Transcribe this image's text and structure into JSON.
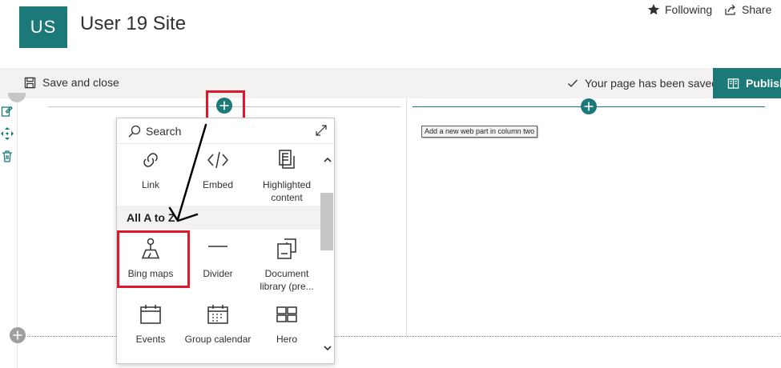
{
  "site": {
    "logo_text": "US",
    "title": "User 19 Site"
  },
  "header_actions": {
    "following_label": "Following",
    "share_label": "Share"
  },
  "command_bar": {
    "save_close_label": "Save and close",
    "saved_status": "Your page has been saved",
    "publish_label": "Publish"
  },
  "tooltip": {
    "text": "Add a new web part in column two"
  },
  "toolbox": {
    "search_placeholder": "Search",
    "top_items": [
      {
        "label": "Link",
        "icon": "link-icon"
      },
      {
        "label": "Embed",
        "icon": "embed-icon"
      },
      {
        "label": "Highlighted content",
        "icon": "highlighted-content-icon"
      }
    ],
    "section_label": "All A to Z",
    "items": [
      {
        "label": "Bing maps",
        "icon": "bing-maps-icon"
      },
      {
        "label": "Divider",
        "icon": "divider-icon"
      },
      {
        "label": "Document library (pre...",
        "icon": "document-library-icon"
      },
      {
        "label": "Events",
        "icon": "events-icon"
      },
      {
        "label": "Group calendar",
        "icon": "group-calendar-icon"
      },
      {
        "label": "Hero",
        "icon": "hero-icon"
      }
    ]
  },
  "colors": {
    "accent": "#1b7a78",
    "highlight": "#e0182e",
    "command_bar_bg": "#f3f2f1"
  }
}
